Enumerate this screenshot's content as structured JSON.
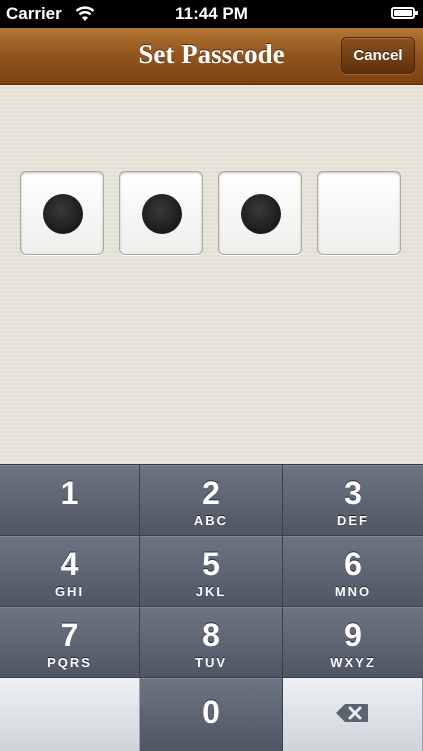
{
  "status_bar": {
    "carrier": "Carrier",
    "time": "11:44 PM",
    "wifi_icon": "wifi-icon",
    "battery_icon": "battery-icon"
  },
  "nav_bar": {
    "title": "Set Passcode",
    "cancel_label": "Cancel"
  },
  "passcode": {
    "length": 4,
    "entered": 3
  },
  "keypad": {
    "keys": [
      {
        "digit": "1",
        "letters": ""
      },
      {
        "digit": "2",
        "letters": "ABC"
      },
      {
        "digit": "3",
        "letters": "DEF"
      },
      {
        "digit": "4",
        "letters": "GHI"
      },
      {
        "digit": "5",
        "letters": "JKL"
      },
      {
        "digit": "6",
        "letters": "MNO"
      },
      {
        "digit": "7",
        "letters": "PQRS"
      },
      {
        "digit": "8",
        "letters": "TUV"
      },
      {
        "digit": "9",
        "letters": "WXYZ"
      }
    ],
    "zero": {
      "digit": "0"
    },
    "delete_icon": "delete-icon"
  },
  "colors": {
    "nav_brown": "#94561f",
    "keypad_gray": "#5b6270",
    "background_beige": "#e6e3d9"
  }
}
